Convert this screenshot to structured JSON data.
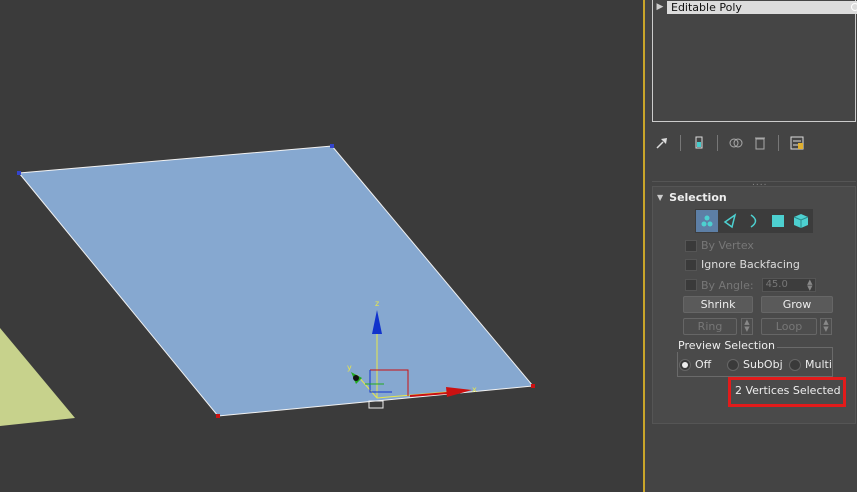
{
  "modifier_stack": {
    "item_label": "Editable Poly"
  },
  "stack_toolbar": {
    "icons": [
      "pin-stack-icon",
      "show-end-result-icon",
      "make-unique-icon",
      "remove-modifier-icon",
      "configure-modifier-sets-icon"
    ]
  },
  "selection_rollout": {
    "title": "Selection",
    "levels": [
      "vertex",
      "edge",
      "border",
      "polygon",
      "element"
    ],
    "active_level": "vertex",
    "by_vertex_label": "By Vertex",
    "ignore_backfacing_label": "Ignore Backfacing",
    "by_angle_label": "By Angle:",
    "by_angle_value": "45.0",
    "shrink_label": "Shrink",
    "grow_label": "Grow",
    "ring_label": "Ring",
    "loop_label": "Loop",
    "preview_selection": {
      "label": "Preview Selection",
      "options": [
        "Off",
        "SubObj",
        "Multi"
      ],
      "selected": "Off"
    },
    "status_text": "2 Vertices Selected"
  },
  "viewport": {
    "gizmo_axis_labels": {
      "x": "x",
      "y": "y",
      "z": "z"
    },
    "colors": {
      "plane": "#86a8d0",
      "x_axis": "#cc1111",
      "y_axis": "#22aa22",
      "z_axis": "#1133cc",
      "highlight": "#e21b1b"
    }
  }
}
